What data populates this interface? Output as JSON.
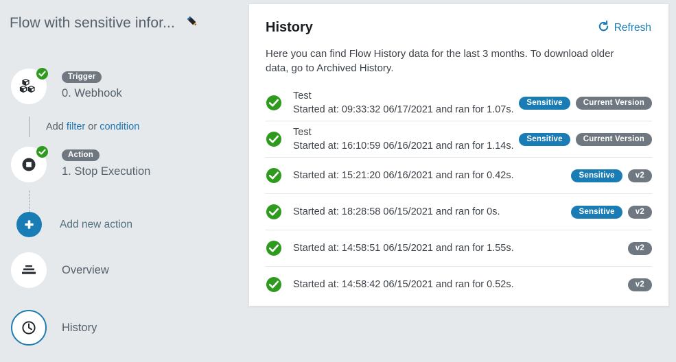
{
  "flow": {
    "title": "Flow with sensitive infor...",
    "edit_icon": "pencil-icon",
    "steps": [
      {
        "tag": "Trigger",
        "name": "0. Webhook",
        "icon": "boxes-icon",
        "status": "check-circle-icon"
      },
      {
        "tag": "Action",
        "name": "1. Stop Execution",
        "icon": "stop-icon",
        "status": "check-circle-icon"
      }
    ],
    "add_filter": {
      "prefix": "Add",
      "filter_link": "filter",
      "separator": "or",
      "condition_link": "condition"
    },
    "add_new_action": {
      "label": "Add new action",
      "icon": "plus-icon"
    },
    "nav": [
      {
        "label": "Overview",
        "icon": "overview-icon",
        "selected": false
      },
      {
        "label": "History",
        "icon": "clock-icon",
        "selected": true
      }
    ]
  },
  "history": {
    "title": "History",
    "refresh_label": "Refresh",
    "refresh_icon": "refresh-icon",
    "description": "Here you can find Flow History data for the last 3 months. To download older data, go to Archived History.",
    "rows": [
      {
        "status_icon": "check-circle-icon",
        "title": "Test",
        "detail": "Started at: 09:33:32 06/17/2021 and ran for 1.07s.",
        "badges": [
          "Sensitive",
          "Current Version"
        ]
      },
      {
        "status_icon": "check-circle-icon",
        "title": "Test",
        "detail": "Started at: 16:10:59 06/16/2021 and ran for 1.14s.",
        "badges": [
          "Sensitive",
          "Current Version"
        ]
      },
      {
        "status_icon": "check-circle-icon",
        "title": "",
        "detail": "Started at: 15:21:20 06/16/2021 and ran for 0.42s.",
        "badges": [
          "Sensitive",
          "v2"
        ]
      },
      {
        "status_icon": "check-circle-icon",
        "title": "",
        "detail": "Started at: 18:28:58 06/15/2021 and ran for 0s.",
        "badges": [
          "Sensitive",
          "v2"
        ]
      },
      {
        "status_icon": "check-circle-icon",
        "title": "",
        "detail": "Started at: 14:58:51 06/15/2021 and ran for 1.55s.",
        "badges": [
          "v2"
        ]
      },
      {
        "status_icon": "check-circle-icon",
        "title": "",
        "detail": "Started at: 14:58:42 06/15/2021 and ran for 0.52s.",
        "badges": [
          "v2"
        ]
      }
    ]
  },
  "colors": {
    "accent_blue": "#1a7cb4",
    "badge_gray": "#6f7780",
    "success_green": "#2e9b1e",
    "page_background": "#e5e9ec",
    "card_background": "#ffffff"
  }
}
